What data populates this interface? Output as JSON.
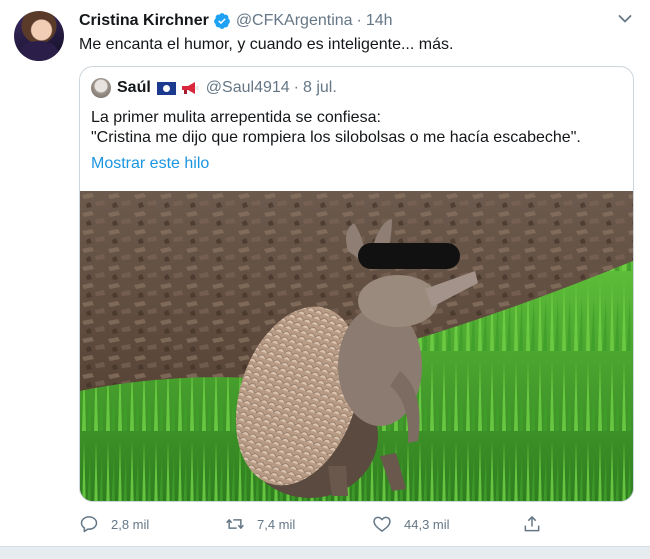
{
  "tweet": {
    "author_name": "Cristina Kirchner",
    "author_handle": "@CFKArgentina",
    "separator": "·",
    "time": "14h",
    "text": "Me encanta el humor, y cuando es inteligente... más.",
    "icons": {
      "verified": "verified-badge-icon",
      "menu": "chevron-down-icon"
    },
    "accent_color": "#1da1f2"
  },
  "quote": {
    "author_name": "Saúl",
    "author_handle": "@Saul4914",
    "separator": "·",
    "time": "8 jul.",
    "line1": "La primer mulita arrepentida se confiesa:",
    "line2": "\"Cristina me dijo que rompiera los silobolsas o me hacía escabeche\".",
    "thread_link": "Mostrar este hilo",
    "emoji_icons": [
      "belize-flag-icon",
      "megaphone-icon"
    ],
    "image_description_icon": "armadillo-photo"
  },
  "actions": {
    "reply_count": "2,8 mil",
    "retweet_count": "7,4 mil",
    "like_count": "44,3 mil",
    "icons": [
      "reply-icon",
      "retweet-icon",
      "like-icon",
      "share-icon"
    ]
  },
  "colors": {
    "text_primary": "#14171a",
    "text_secondary": "#657786",
    "link": "#1b95e0",
    "border": "#ccd6dd",
    "background_strip": "#e6ecf0"
  }
}
